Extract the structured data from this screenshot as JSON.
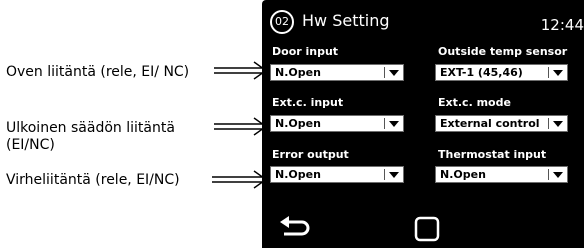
{
  "annotations": [
    {
      "text": "Oven liitäntä (rele, EI/ NC)"
    },
    {
      "text": "Ulkoinen säädön liitäntä (EI/NC)"
    },
    {
      "text": "Virheliitäntä (rele, EI/NC)"
    }
  ],
  "screen": {
    "page_number": "02",
    "title": "Hw Setting",
    "time": "12:44",
    "fields": {
      "door_input": {
        "label": "Door input",
        "value": "N.Open"
      },
      "outside_temp_sensor": {
        "label": "Outside temp sensor",
        "value": "EXT-1 (45,46)"
      },
      "extc_input": {
        "label": "Ext.c. input",
        "value": "N.Open"
      },
      "extc_mode": {
        "label": "Ext.c. mode",
        "value": "External control"
      },
      "error_output": {
        "label": "Error output",
        "value": "N.Open"
      },
      "thermostat_input": {
        "label": "Thermostat input",
        "value": "N.Open"
      }
    },
    "nav": {
      "back_icon": "back-arrow-icon",
      "home_icon": "home-square-icon"
    }
  },
  "colors": {
    "screen_background": "#000000",
    "dropdown_background": "#ffffff",
    "text_on_screen": "#ffffff"
  }
}
